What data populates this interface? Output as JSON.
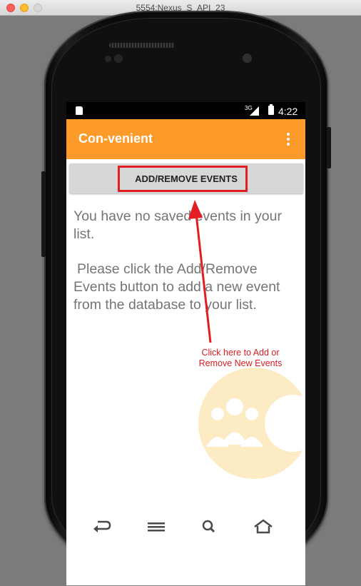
{
  "window": {
    "title": "5554:Nexus_S_API_23"
  },
  "status_bar": {
    "network": "3G",
    "time": "4:22"
  },
  "app_bar": {
    "title": "Con-venient",
    "menu_icon": "overflow-menu-icon"
  },
  "main": {
    "button_label": "ADD/REMOVE EVENTS",
    "empty_message": "You have no saved events in your list.",
    "instruction": "Please click the Add/Remove Events button to add a new event from the database to your list."
  },
  "annotation": {
    "callout_text": "Click here to Add or Remove New Events",
    "color": "#e41d23"
  },
  "colors": {
    "accent": "#fd9b2a",
    "watermark": "#fbe7b8"
  },
  "nav": {
    "icons": [
      "back-icon",
      "menu-icon",
      "search-icon",
      "home-icon"
    ]
  }
}
